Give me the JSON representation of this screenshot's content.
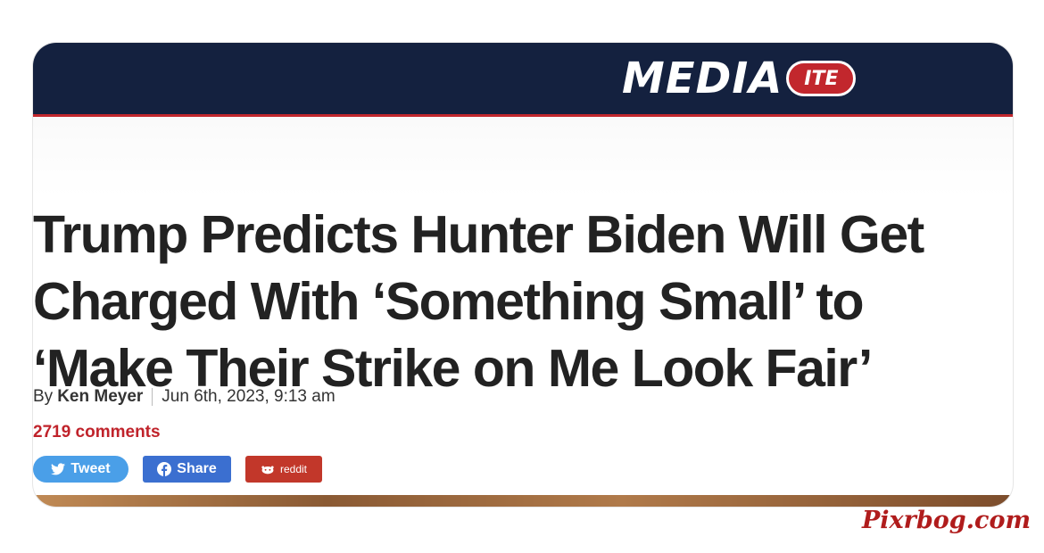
{
  "masthead": {
    "logo_word": "MEDIA",
    "logo_badge": "ITE",
    "brand_color": "#14213f",
    "accent_color": "#c2272d"
  },
  "article": {
    "headline_lines": [
      "Trump Predicts Hunter Biden Will Get",
      "Charged With ‘Something Small’ to",
      "‘Make Their Strike on Me Look Fair’"
    ],
    "byline_prefix": "By",
    "author": "Ken Meyer",
    "date": "Jun 6th, 2023, 9:13 am",
    "comments": "2719 comments"
  },
  "share": {
    "tweet_label": "Tweet",
    "share_label": "Share",
    "reddit_label": "reddit",
    "icons": [
      "twitter-icon",
      "facebook-icon",
      "reddit-icon"
    ]
  },
  "watermark": "Pixrbog.com"
}
